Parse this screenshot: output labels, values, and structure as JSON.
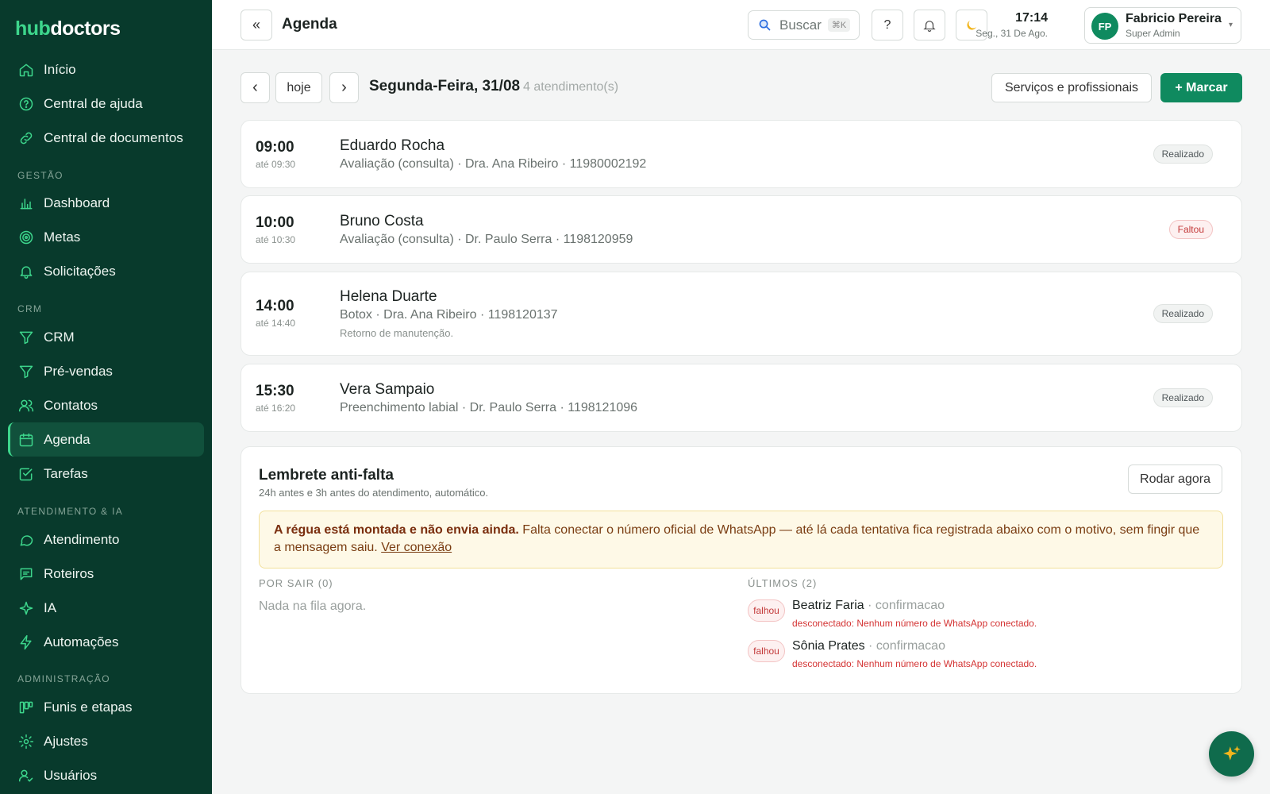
{
  "brand": {
    "part1": "hub",
    "part2": "doctors"
  },
  "sidebar": {
    "top": [
      {
        "label": "Início",
        "icon": "home-icon"
      },
      {
        "label": "Central de ajuda",
        "icon": "help-circle-icon"
      },
      {
        "label": "Central de documentos",
        "icon": "link-icon"
      }
    ],
    "sections": [
      {
        "title": "GESTÃO",
        "items": [
          {
            "label": "Dashboard",
            "icon": "bar-chart-icon"
          },
          {
            "label": "Metas",
            "icon": "target-icon"
          },
          {
            "label": "Solicitações",
            "icon": "bell-icon"
          }
        ]
      },
      {
        "title": "CRM",
        "items": [
          {
            "label": "CRM",
            "icon": "filter-icon"
          },
          {
            "label": "Pré-vendas",
            "icon": "filter-icon"
          },
          {
            "label": "Contatos",
            "icon": "users-icon"
          },
          {
            "label": "Agenda",
            "icon": "calendar-icon",
            "active": true
          },
          {
            "label": "Tarefas",
            "icon": "check-square-icon"
          }
        ]
      },
      {
        "title": "ATENDIMENTO & IA",
        "items": [
          {
            "label": "Atendimento",
            "icon": "chat-bubble-icon"
          },
          {
            "label": "Roteiros",
            "icon": "message-square-icon"
          },
          {
            "label": "IA",
            "icon": "sparkle-icon"
          },
          {
            "label": "Automações",
            "icon": "lightning-icon"
          }
        ]
      },
      {
        "title": "ADMINISTRAÇÃO",
        "items": [
          {
            "label": "Funis e etapas",
            "icon": "kanban-icon"
          },
          {
            "label": "Ajustes",
            "icon": "gear-icon"
          },
          {
            "label": "Usuários",
            "icon": "user-check-icon"
          }
        ]
      }
    ]
  },
  "header": {
    "collapse_label": "«",
    "title": "Agenda",
    "search_label": "Buscar",
    "search_shortcut": "⌘K",
    "help_label": "?",
    "time": "17:14",
    "date": "Seg., 31 De Ago.",
    "user": {
      "initials": "FP",
      "name": "Fabricio Pereira",
      "role": "Super Admin"
    }
  },
  "toolbar": {
    "prev": "‹",
    "today": "hoje",
    "next": "›",
    "date_label": "Segunda-Feira, 31/08",
    "count": "4 atendimento(s)",
    "services_button": "Serviços e profissionais",
    "new_button": "+ Marcar"
  },
  "appointments": [
    {
      "time": "09:00",
      "until": "até 09:30",
      "name": "Eduardo Rocha",
      "details": "Avaliação (consulta) · Dra. Ana Ribeiro · 11980002192",
      "note": "",
      "status": "Realizado",
      "status_type": "ok"
    },
    {
      "time": "10:00",
      "until": "até 10:30",
      "name": "Bruno Costa",
      "details": "Avaliação (consulta) · Dr. Paulo Serra · 1198120959",
      "note": "",
      "status": "Faltou",
      "status_type": "fail"
    },
    {
      "time": "14:00",
      "until": "até 14:40",
      "name": "Helena Duarte",
      "details": "Botox · Dra. Ana Ribeiro · 1198120137",
      "note": "Retorno de manutenção.",
      "status": "Realizado",
      "status_type": "ok"
    },
    {
      "time": "15:30",
      "until": "até 16:20",
      "name": "Vera Sampaio",
      "details": "Preenchimento labial · Dr. Paulo Serra · 1198121096",
      "note": "",
      "status": "Realizado",
      "status_type": "ok"
    }
  ],
  "reminder": {
    "title": "Lembrete anti-falta",
    "subtitle": "24h antes e 3h antes do atendimento, automático.",
    "run_button": "Rodar agora",
    "warning_bold": "A régua está montada e não envia ainda.",
    "warning_text": " Falta conectar o número oficial de WhatsApp — até lá cada tentativa fica registrada abaixo com o motivo, sem fingir que a mensagem saiu. ",
    "warning_link": "Ver conexão",
    "queue_title": "POR SAIR (0)",
    "queue_empty": "Nada na fila agora.",
    "recent_title": "ÚLTIMOS (2)",
    "recent": [
      {
        "status": "falhou",
        "name": "Beatriz Faria",
        "type": " · confirmacao",
        "error": "desconectado: Nenhum número de WhatsApp conectado."
      },
      {
        "status": "falhou",
        "name": "Sônia Prates",
        "type": " · confirmacao",
        "error": "desconectado: Nenhum número de WhatsApp conectado."
      }
    ]
  },
  "colors": {
    "sidebar_bg": "#083a2c",
    "accent": "#3dd68c",
    "primary": "#0f8a5f",
    "danger": "#c33a3a"
  }
}
